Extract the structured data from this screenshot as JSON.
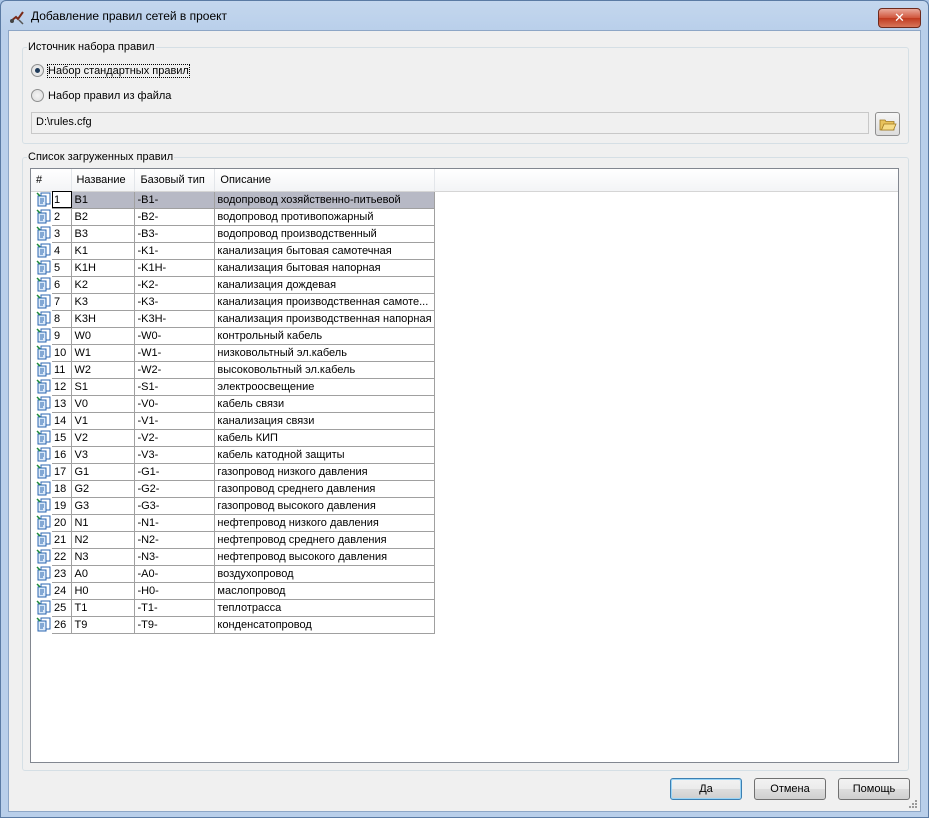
{
  "window": {
    "title": "Добавление правил сетей в проект",
    "close_label": "✕"
  },
  "source_group": {
    "legend": "Источник набора правил",
    "radio_standard": "Набор стандартных правил",
    "radio_file": "Набор правил из файла",
    "selected": "standard",
    "path_value": "D:\\rules.cfg"
  },
  "rules_group": {
    "legend": "Список загруженных правил",
    "columns": [
      "#",
      "Название",
      "Базовый тип",
      "Описание"
    ],
    "selected_row": 0,
    "rows": [
      {
        "num": "1",
        "name": "B1",
        "type": "-B1-",
        "desc": "водопровод хозяйственно-питьевой"
      },
      {
        "num": "2",
        "name": "B2",
        "type": "-B2-",
        "desc": "водопровод противопожарный"
      },
      {
        "num": "3",
        "name": "B3",
        "type": "-B3-",
        "desc": "водопровод производственный"
      },
      {
        "num": "4",
        "name": "K1",
        "type": "-K1-",
        "desc": "канализация бытовая самотечная"
      },
      {
        "num": "5",
        "name": "K1H",
        "type": "-K1H-",
        "desc": "канализация бытовая напорная"
      },
      {
        "num": "6",
        "name": "K2",
        "type": "-K2-",
        "desc": "канализация дождевая"
      },
      {
        "num": "7",
        "name": "K3",
        "type": "-K3-",
        "desc": "канализация производственная самоте..."
      },
      {
        "num": "8",
        "name": "K3H",
        "type": "-K3H-",
        "desc": "канализация производственная напорная"
      },
      {
        "num": "9",
        "name": "W0",
        "type": "-W0-",
        "desc": "контрольный кабель"
      },
      {
        "num": "10",
        "name": "W1",
        "type": "-W1-",
        "desc": "низковольтный эл.кабель"
      },
      {
        "num": "11",
        "name": "W2",
        "type": "-W2-",
        "desc": "высоковольтный эл.кабель"
      },
      {
        "num": "12",
        "name": "S1",
        "type": "-S1-",
        "desc": "электроосвещение"
      },
      {
        "num": "13",
        "name": "V0",
        "type": "-V0-",
        "desc": "кабель связи"
      },
      {
        "num": "14",
        "name": "V1",
        "type": "-V1-",
        "desc": "канализация связи"
      },
      {
        "num": "15",
        "name": "V2",
        "type": "-V2-",
        "desc": "кабель КИП"
      },
      {
        "num": "16",
        "name": "V3",
        "type": "-V3-",
        "desc": "кабель катодной защиты"
      },
      {
        "num": "17",
        "name": "G1",
        "type": "-G1-",
        "desc": "газопровод низкого давления"
      },
      {
        "num": "18",
        "name": "G2",
        "type": "-G2-",
        "desc": "газопровод среднего давления"
      },
      {
        "num": "19",
        "name": "G3",
        "type": "-G3-",
        "desc": "газопровод высокого давления"
      },
      {
        "num": "20",
        "name": "N1",
        "type": "-N1-",
        "desc": "нефтепровод низкого давления"
      },
      {
        "num": "21",
        "name": "N2",
        "type": "-N2-",
        "desc": "нефтепровод среднего давления"
      },
      {
        "num": "22",
        "name": "N3",
        "type": "-N3-",
        "desc": "нефтепровод высокого давления"
      },
      {
        "num": "23",
        "name": "A0",
        "type": "-A0-",
        "desc": "воздухопровод"
      },
      {
        "num": "24",
        "name": "H0",
        "type": "-H0-",
        "desc": "маслопровод"
      },
      {
        "num": "25",
        "name": "T1",
        "type": "-T1-",
        "desc": "теплотрасса"
      },
      {
        "num": "26",
        "name": "T9",
        "type": "-T9-",
        "desc": "конденсатопровод"
      }
    ]
  },
  "buttons": {
    "ok": "Да",
    "cancel": "Отмена",
    "help": "Помощь"
  },
  "colors": {
    "selection": "#b7b9c5",
    "title_bar": "#b9cfea",
    "close_button": "#c03a1f"
  },
  "icons": {
    "app": "network-tool-icon",
    "close": "close-icon",
    "folder": "folder-open-icon",
    "row": "rule-document-icon",
    "grip": "resize-grip-icon"
  }
}
